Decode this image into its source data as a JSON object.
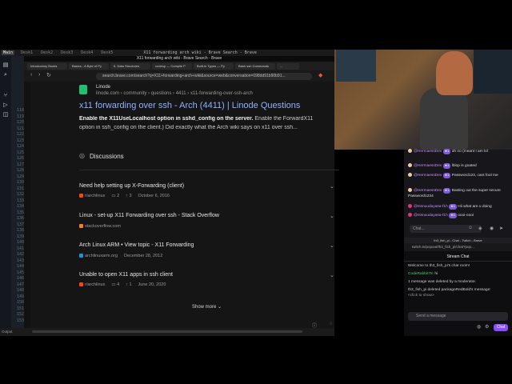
{
  "workspaces": [
    "Main",
    "Desk1",
    "Desk2",
    "Desk3",
    "Desk4",
    "Desk5"
  ],
  "window_title": "X11 forwarding arch wiki - Brave Search - Brave",
  "browser": {
    "title_strip": "X11 forwarding arch wiki - Brave Search - Brave",
    "tabs": [
      "Introductory Books",
      "Basics - A Byte of Py",
      "5. Data Structures",
      "codeop — Compile P",
      "Built-in Types — Py",
      "Bash ssh Commands",
      "..."
    ],
    "url": "search.brave.com/search?q=X11+forwarding+arch+wiki&source=web&conversation=098dd91b90b91..."
  },
  "result": {
    "site_name": "Linode",
    "crumb": "linode.com › community › questions › 4411 › x11-forwarding-over-ssh-arch",
    "title": "x11 forwarding over ssh - Arch (4411) | Linode Questions",
    "snippet_bold": "Enable the X11UseLocalhost option in sshd_config on the server.",
    "snippet_rest": " Enable the ForwardX11",
    "snippet_line2": "option in ssh_config on the client.) Did exactly what the Arch wiki says on x11 over ssh..."
  },
  "discussions": {
    "heading": "Discussions",
    "items": [
      {
        "title": "Need help setting up X-Forwarding (client)",
        "source": "r/archlinux",
        "comments": "2",
        "votes": "3",
        "date": "October 6, 2016",
        "icon_color": "#ff4500"
      },
      {
        "title": "Linux - set-up X11 Forwarding over ssh - Stack Overflow",
        "source": "stackoverflow.com",
        "comments": "",
        "votes": "",
        "date": "",
        "icon_color": "#f48024"
      },
      {
        "title": "Arch Linux ARM • View topic - X11 Forwarding",
        "source": "archlinuxarm.org",
        "comments": "",
        "votes": "",
        "date": "December 28, 2012",
        "icon_color": "#1793d1"
      },
      {
        "title": "Unable to open X11 apps in ssh client",
        "source": "r/archlinux",
        "comments": "4",
        "votes": "1",
        "date": "June 20, 2020",
        "icon_color": "#ff4500"
      }
    ],
    "show_more": "Show more"
  },
  "gutter_lines": [
    "115",
    "116",
    "117",
    "118",
    "119",
    "120",
    "121",
    "122",
    "123",
    "124",
    "125",
    "126",
    "127",
    "128",
    "129",
    "130",
    "131",
    "132",
    "133",
    "134",
    "135",
    "136",
    "137",
    "138",
    "139",
    "140",
    "141",
    "142",
    "143",
    "144",
    "145",
    "146",
    "147",
    "148",
    "149",
    "150",
    "151",
    "152",
    "153"
  ],
  "status": {
    "left": "Output"
  },
  "chat_top": {
    "messages": [
      {
        "user": "@HermaessDev",
        "badge": "★1",
        "text": "oh no (meant I am lol"
      },
      {
        "user": "@HermaessDev",
        "badge": "★1",
        "text": "lblop is goated"
      },
      {
        "user": "@HermaessDev",
        "badge": "★1",
        "text": "Password123, cant fool me"
      },
      {
        "user": "@HermaessDev",
        "badge": "★1",
        "text": "Basting out the super secure Password1234"
      },
      {
        "user": "@Issnuudayasa-f1h",
        "badge": "★1",
        "text": "Hii what are u doing"
      },
      {
        "user": "@Issnuudayasa-f1h",
        "badge": "★1",
        "text": "oooi-oooi"
      }
    ],
    "input_placeholder": "Chat..."
  },
  "chat_popout": {
    "bar_title": "th3_fish_pi - Chat - Twitch - Brave",
    "url": "twitch.tv/popout/th3_fish_pi/chat?pop...",
    "header": "Stream Chat",
    "welcome": "Welcome to th3_fish_pi's chat room!",
    "user_line_name": "CodeRabbit78:",
    "user_line_text": "hi",
    "deleted_1": "1 message was deleted by a moderator.",
    "deleted_2": "th3_fish_pi deleted packageRedBold's message:",
    "deleted_3": "<click to show>",
    "input_placeholder": "Send a message",
    "chat_button": "Chat"
  }
}
